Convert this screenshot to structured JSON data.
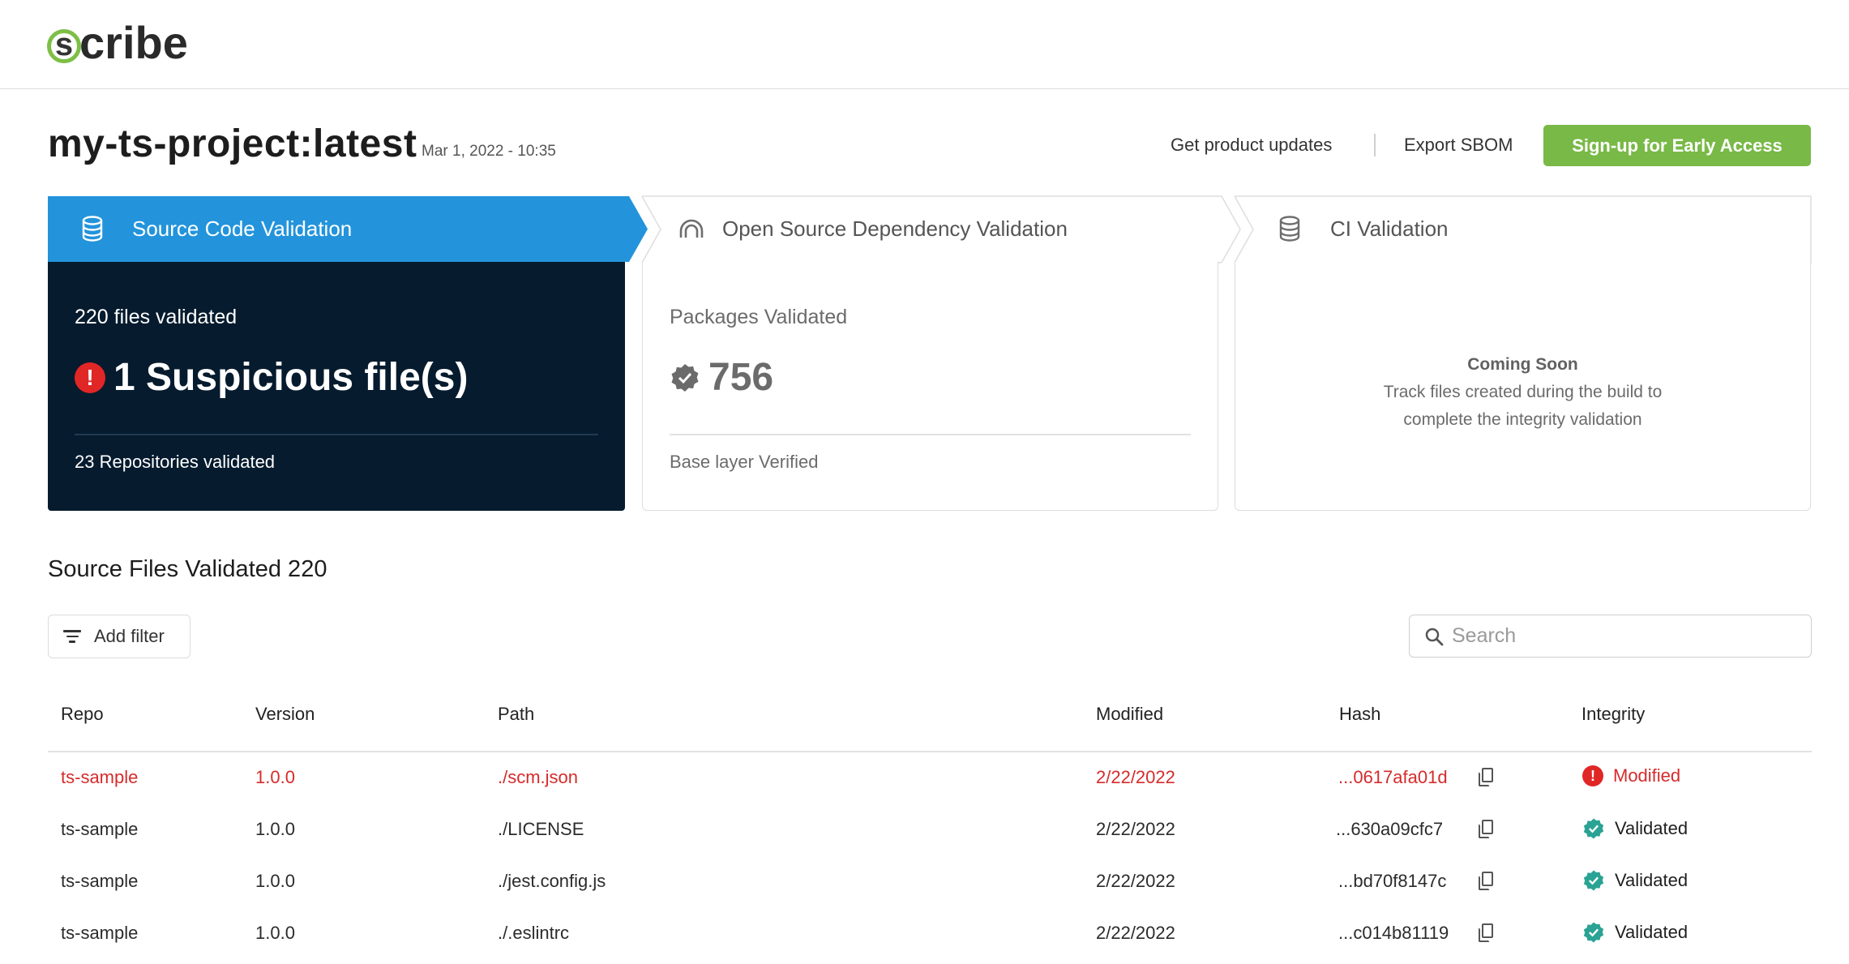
{
  "brand": {
    "logo_letter": "s",
    "logo_rest": "cribe",
    "accent": "#79b947"
  },
  "page": {
    "title": "my-ts-project:latest",
    "timestamp": "Mar 1, 2022 - 10:35",
    "links": {
      "updates": "Get product updates",
      "export": "Export SBOM"
    },
    "cta_label": "Sign-up for Early Access"
  },
  "steps": [
    {
      "label": "Source Code Validation",
      "icon": "database-icon",
      "active": true
    },
    {
      "label": "Open Source Dependency Validation",
      "icon": "rainbow-arch-icon",
      "active": false
    },
    {
      "label": "CI Validation",
      "icon": "database-icon",
      "active": false
    }
  ],
  "panels": {
    "source": {
      "files_validated": "220 files validated",
      "suspicious_count": "1",
      "suspicious_label": "1 Suspicious file(s)",
      "repos": "23 Repositories validated"
    },
    "dependency": {
      "heading": "Packages Validated",
      "count": "756",
      "footer": "Base layer Verified"
    },
    "ci": {
      "title": "Coming Soon",
      "line1": "Track files created during the build to",
      "line2": "complete the integrity validation"
    }
  },
  "table": {
    "title": "Source Files Validated 220",
    "filter_label": "Add filter",
    "search_placeholder": "Search",
    "columns": [
      "Repo",
      "Version",
      "Path",
      "Modified",
      "Hash",
      "Integrity"
    ],
    "rows": [
      {
        "repo": "ts-sample",
        "version": "1.0.0",
        "path": "./scm.json",
        "modified": "2/22/2022",
        "hash": "...0617afa01d",
        "integrity": "Modified",
        "status": "modified"
      },
      {
        "repo": "ts-sample",
        "version": "1.0.0",
        "path": "./LICENSE",
        "modified": "2/22/2022",
        "hash": "...630a09cfc7",
        "integrity": "Validated",
        "status": "validated"
      },
      {
        "repo": "ts-sample",
        "version": "1.0.0",
        "path": "./jest.config.js",
        "modified": "2/22/2022",
        "hash": "...bd70f8147c",
        "integrity": "Validated",
        "status": "validated"
      },
      {
        "repo": "ts-sample",
        "version": "1.0.0",
        "path": "./.eslintrc",
        "modified": "2/22/2022",
        "hash": "...c014b81119",
        "integrity": "Validated",
        "status": "validated"
      }
    ]
  },
  "colors": {
    "active_tab": "#2394db",
    "dark_panel": "#061b2e",
    "alert_red": "#e12626",
    "validated_teal": "#2aa394"
  }
}
